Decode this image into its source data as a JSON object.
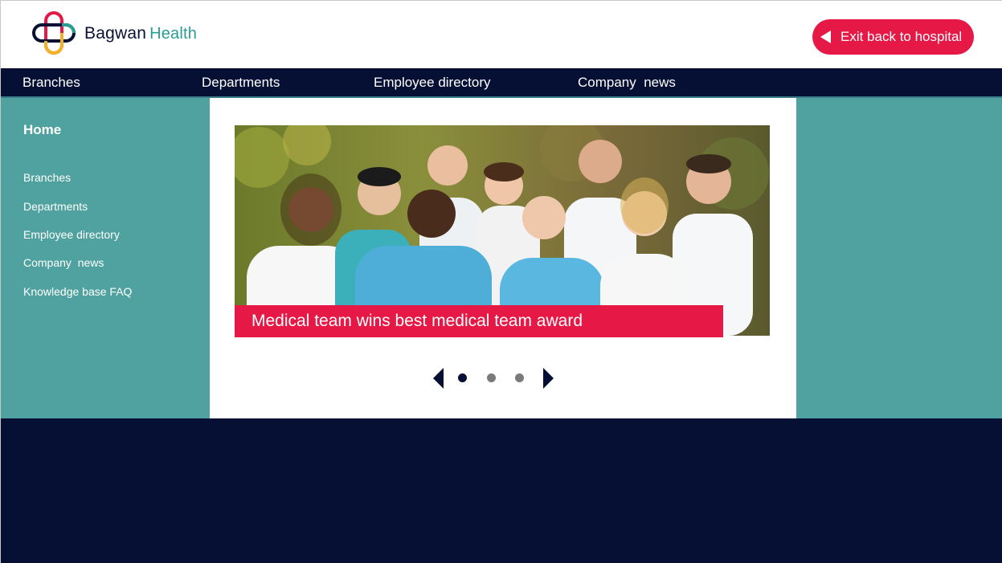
{
  "header": {
    "brand_name": "Bagwan",
    "brand_sub": "Health",
    "exit_label": "Exit back to hospital"
  },
  "topnav": {
    "items": [
      "Branches",
      "Departments",
      "Employee directory",
      "Company  news"
    ]
  },
  "sidebar": {
    "home_label": "Home",
    "links": [
      "Branches",
      "Departments",
      "Employee directory",
      "Company  news",
      "Knowledge base FAQ"
    ]
  },
  "carousel": {
    "caption": "Medical team wins best medical team award",
    "slide_count": 3,
    "active_index": 0
  },
  "colors": {
    "navy": "#061034",
    "teal": "#4fa29f",
    "accent": "#e51846",
    "dot_inactive": "#7a7a7a"
  },
  "icons": {
    "logo": "interlocked-cross-logo-icon",
    "exit": "triangle-left-icon",
    "prev": "chevron-left-icon",
    "next": "chevron-right-icon"
  }
}
